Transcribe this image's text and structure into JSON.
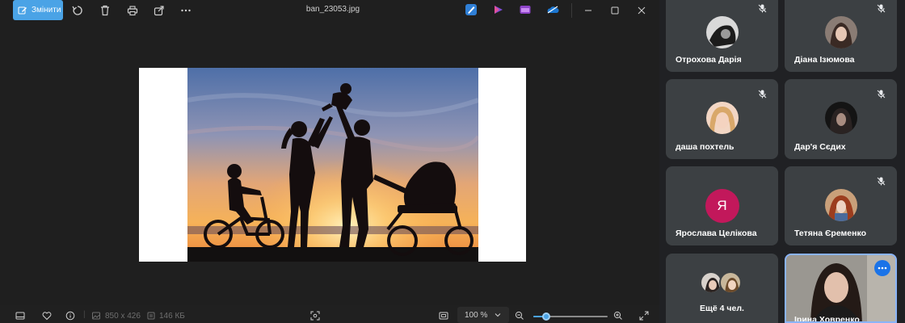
{
  "viewer": {
    "edit_label": "Змінити",
    "filename": "ban_23053.jpg",
    "status": {
      "dimensions": "850 x 426",
      "filesize": "146 КБ",
      "zoom": "100 %",
      "zoom_level_percent": 17
    },
    "icons": [
      "edit-icon",
      "rotate-icon",
      "delete-icon",
      "print-icon",
      "share-icon",
      "more-icon",
      "edit-app-icon",
      "clipchamp-icon",
      "video-editor-icon",
      "onedrive-icon",
      "minimize-icon",
      "maximize-icon",
      "close-icon"
    ]
  },
  "meet": {
    "participants": [
      {
        "name": "Отрохова Дарія",
        "avatar": "photo"
      },
      {
        "name": "Діана Ізюмова",
        "avatar": "photo"
      },
      {
        "name": "даша похтель",
        "avatar": "photo"
      },
      {
        "name": "Дар'я Сєдих",
        "avatar": "photo"
      },
      {
        "name": "Ярослава Целікова",
        "avatar": "letter",
        "letter": "Я"
      },
      {
        "name": "Тетяна Єременко",
        "avatar": "photo"
      },
      {
        "name": "Ещё 4 чел.",
        "avatar": "group"
      },
      {
        "name": "Ірина Ховренко",
        "avatar": "video"
      }
    ],
    "colors": {
      "tile": "#3c4043",
      "letter_avatar": "#c2185b",
      "accent": "#1a73e8"
    }
  }
}
